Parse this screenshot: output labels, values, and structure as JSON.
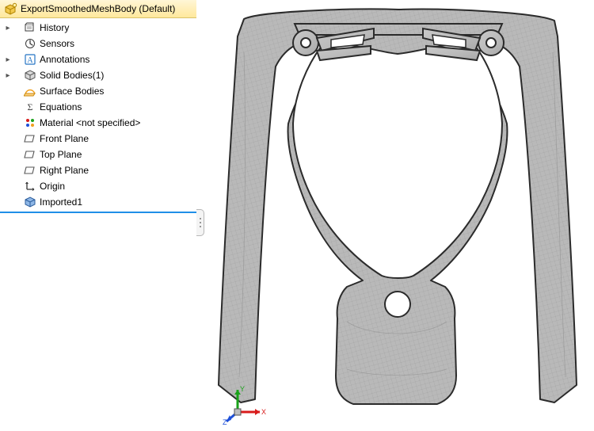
{
  "root": {
    "label": "ExportSmoothedMeshBody  (Default)"
  },
  "tree": {
    "items": [
      {
        "label": "History",
        "expander": "▸",
        "icon": "history-icon"
      },
      {
        "label": "Sensors",
        "expander": "",
        "icon": "sensors-icon"
      },
      {
        "label": "Annotations",
        "expander": "▸",
        "icon": "annotations-icon"
      },
      {
        "label": "Solid Bodies(1)",
        "expander": "▸",
        "icon": "solid-bodies-icon"
      },
      {
        "label": "Surface Bodies",
        "expander": "",
        "icon": "surface-bodies-icon"
      },
      {
        "label": "Equations",
        "expander": "",
        "icon": "equations-icon"
      },
      {
        "label": "Material <not specified>",
        "expander": "",
        "icon": "material-icon"
      },
      {
        "label": "Front Plane",
        "expander": "",
        "icon": "plane-icon"
      },
      {
        "label": "Top Plane",
        "expander": "",
        "icon": "plane-icon"
      },
      {
        "label": "Right Plane",
        "expander": "",
        "icon": "plane-icon"
      },
      {
        "label": "Origin",
        "expander": "",
        "icon": "origin-icon"
      },
      {
        "label": "Imported1",
        "expander": "",
        "icon": "imported-icon"
      }
    ]
  },
  "triad": {
    "x_label": "X",
    "y_label": "Y",
    "z_label": "Z",
    "x_color": "#d81b1b",
    "y_color": "#1aa21a",
    "z_color": "#1d4fd8"
  },
  "colors": {
    "highlight_gold_top": "#fff6d6",
    "highlight_gold_bottom": "#ffe89c",
    "accent_blue": "#1f8fe8"
  }
}
